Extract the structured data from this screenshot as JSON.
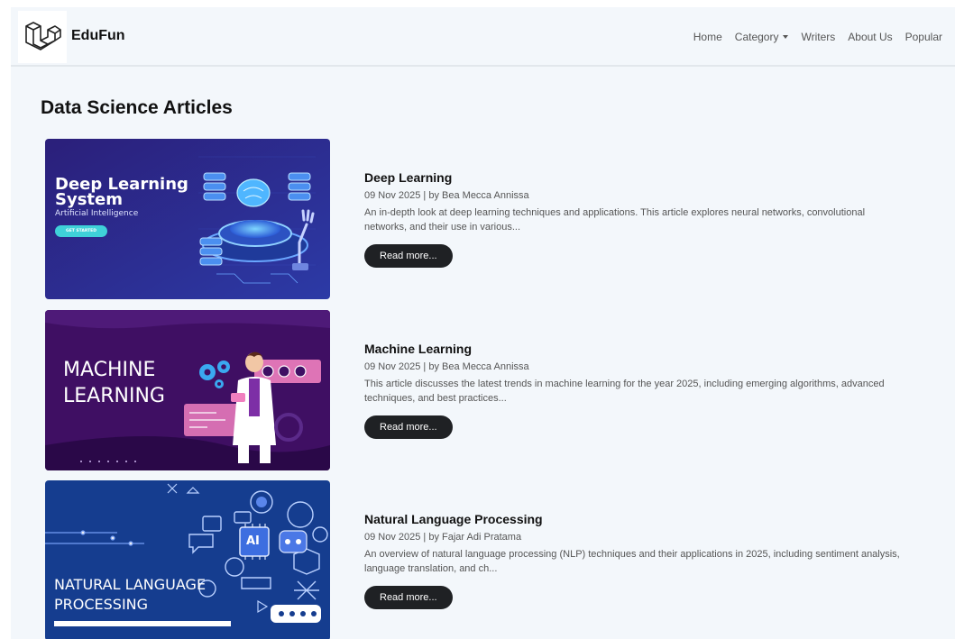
{
  "brand": {
    "name": "EduFun"
  },
  "nav": {
    "home": "Home",
    "category": "Category",
    "writers": "Writers",
    "about": "About Us",
    "popular": "Popular"
  },
  "page_title": "Data Science Articles",
  "articles": [
    {
      "title": "Deep Learning",
      "meta": "09 Nov 2025 | by Bea Mecca Annissa",
      "description": "An in-depth look at deep learning techniques and applications. This article explores neural networks, convolutional networks, and their use in various...",
      "button": "Read more...",
      "thumb": {
        "line1": "Deep Learning",
        "line2": "System",
        "subtitle": "Artificial Intelligence",
        "cta": "GET STARTED"
      }
    },
    {
      "title": "Machine Learning",
      "meta": "09 Nov 2025 | by Bea Mecca Annissa",
      "description": "This article discusses the latest trends in machine learning for the year 2025, including emerging algorithms, advanced techniques, and best practices...",
      "button": "Read more...",
      "thumb": {
        "line1": "MACHINE",
        "line2": "LEARNING"
      }
    },
    {
      "title": "Natural Language Processing",
      "meta": "09 Nov 2025 | by Fajar Adi Pratama",
      "description": "An overview of natural language processing (NLP) techniques and their applications in 2025, including sentiment analysis, language translation, and ch...",
      "button": "Read more...",
      "thumb": {
        "line1": "NATURAL LANGUAGE",
        "line2": "PROCESSING",
        "badge": "AI"
      }
    }
  ],
  "colors": {
    "page_bg": "#f3f7fb",
    "button_bg": "#1f2124",
    "thumb1_bg": "#2a2a8c",
    "thumb2_bg": "#3f0f63",
    "thumb3_bg": "#153d8f"
  }
}
